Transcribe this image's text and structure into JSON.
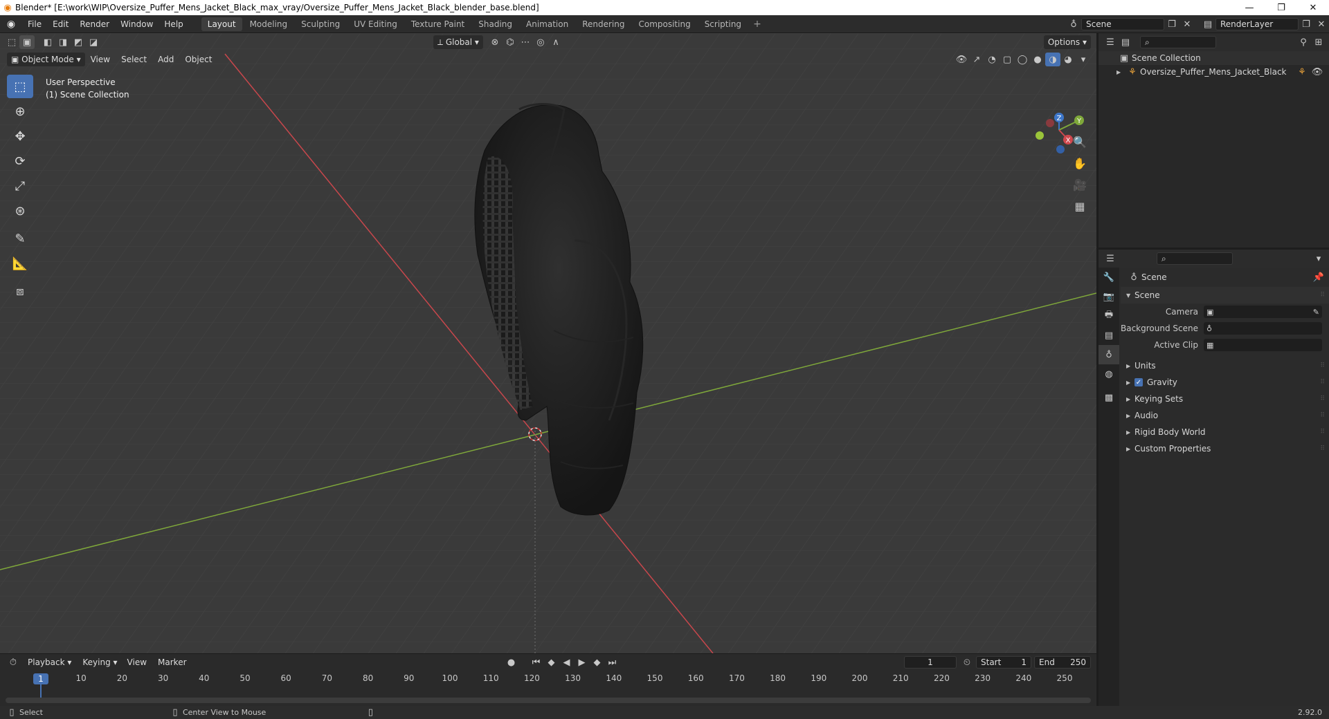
{
  "window": {
    "title": "Blender* [E:\\work\\WIP\\Oversize_Puffer_Mens_Jacket_Black_max_vray/Oversize_Puffer_Mens_Jacket_Black_blender_base.blend]",
    "minimize": "—",
    "restore": "❐",
    "close": "✕"
  },
  "menu": [
    "File",
    "Edit",
    "Render",
    "Window",
    "Help"
  ],
  "workspaces": [
    "Layout",
    "Modeling",
    "Sculpting",
    "UV Editing",
    "Texture Paint",
    "Shading",
    "Animation",
    "Rendering",
    "Compositing",
    "Scripting"
  ],
  "active_workspace": "Layout",
  "scene_selector": {
    "value": "Scene"
  },
  "renderlayer_selector": {
    "value": "RenderLayer"
  },
  "viewport": {
    "mode": "Object Mode",
    "menus": [
      "View",
      "Select",
      "Add",
      "Object"
    ],
    "orientation": "Global",
    "options_label": "Options",
    "perspective_label": "User Perspective",
    "collection_label": "(1) Scene Collection",
    "gizmo": {
      "z": "Z",
      "y": "Y",
      "x": "X"
    }
  },
  "outliner": {
    "root": "Scene Collection",
    "items": [
      {
        "label": "Oversize_Puffer_Mens_Jacket_Black"
      }
    ]
  },
  "properties": {
    "context": "Scene",
    "section": "Scene",
    "fields": [
      {
        "label": "Camera",
        "value": ""
      },
      {
        "label": "Background Scene",
        "value": ""
      },
      {
        "label": "Active Clip",
        "value": ""
      }
    ],
    "panels": [
      "Units",
      "Gravity",
      "Keying Sets",
      "Audio",
      "Rigid Body World",
      "Custom Properties"
    ]
  },
  "timeline": {
    "menus": [
      "Playback",
      "Keying",
      "View",
      "Marker"
    ],
    "current_frame": "1",
    "start_label": "Start",
    "start": "1",
    "end_label": "End",
    "end": "250",
    "ruler": [
      "10",
      "20",
      "30",
      "40",
      "50",
      "60",
      "70",
      "80",
      "90",
      "100",
      "110",
      "120",
      "130",
      "140",
      "150",
      "160",
      "170",
      "180",
      "190",
      "200",
      "210",
      "220",
      "230",
      "240",
      "250"
    ]
  },
  "statusbar": {
    "select": "Select",
    "center_view": "Center View to Mouse",
    "version": "2.92.0"
  },
  "colors": {
    "accent": "#4772b3",
    "x_axis": "#d0484e",
    "y_axis": "#7fa83a",
    "z_axis": "#3d76c9"
  }
}
